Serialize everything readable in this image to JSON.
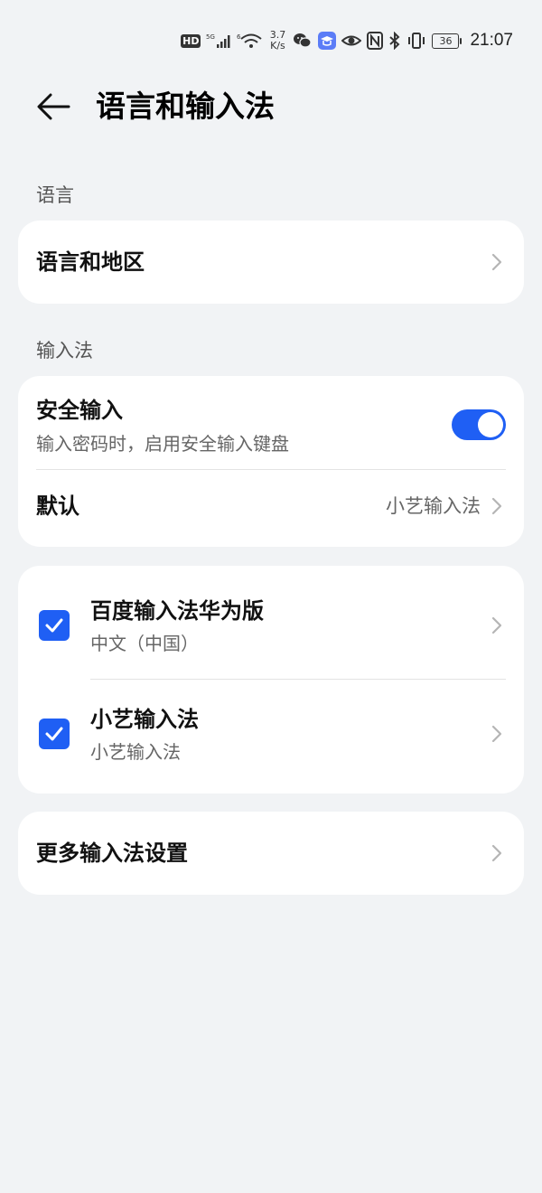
{
  "status_bar": {
    "hd_label": "HD",
    "network_speed_value": "3.7",
    "network_speed_unit": "K/s",
    "battery": "36",
    "time": "21:07"
  },
  "header": {
    "title": "语言和输入法"
  },
  "language_section": {
    "label": "语言",
    "items": [
      {
        "title": "语言和地区"
      }
    ]
  },
  "input_section": {
    "label": "输入法",
    "secure_input": {
      "title": "安全输入",
      "subtitle": "输入密码时，启用安全输入键盘",
      "enabled": true
    },
    "default": {
      "title": "默认",
      "value": "小艺输入法"
    }
  },
  "input_methods": [
    {
      "title": "百度输入法华为版",
      "subtitle": "中文（中国）",
      "checked": true
    },
    {
      "title": "小艺输入法",
      "subtitle": "小艺输入法",
      "checked": true
    }
  ],
  "more_settings": {
    "title": "更多输入法设置"
  },
  "colors": {
    "accent": "#1f5ff4",
    "background": "#f1f3f5",
    "card": "#ffffff"
  }
}
